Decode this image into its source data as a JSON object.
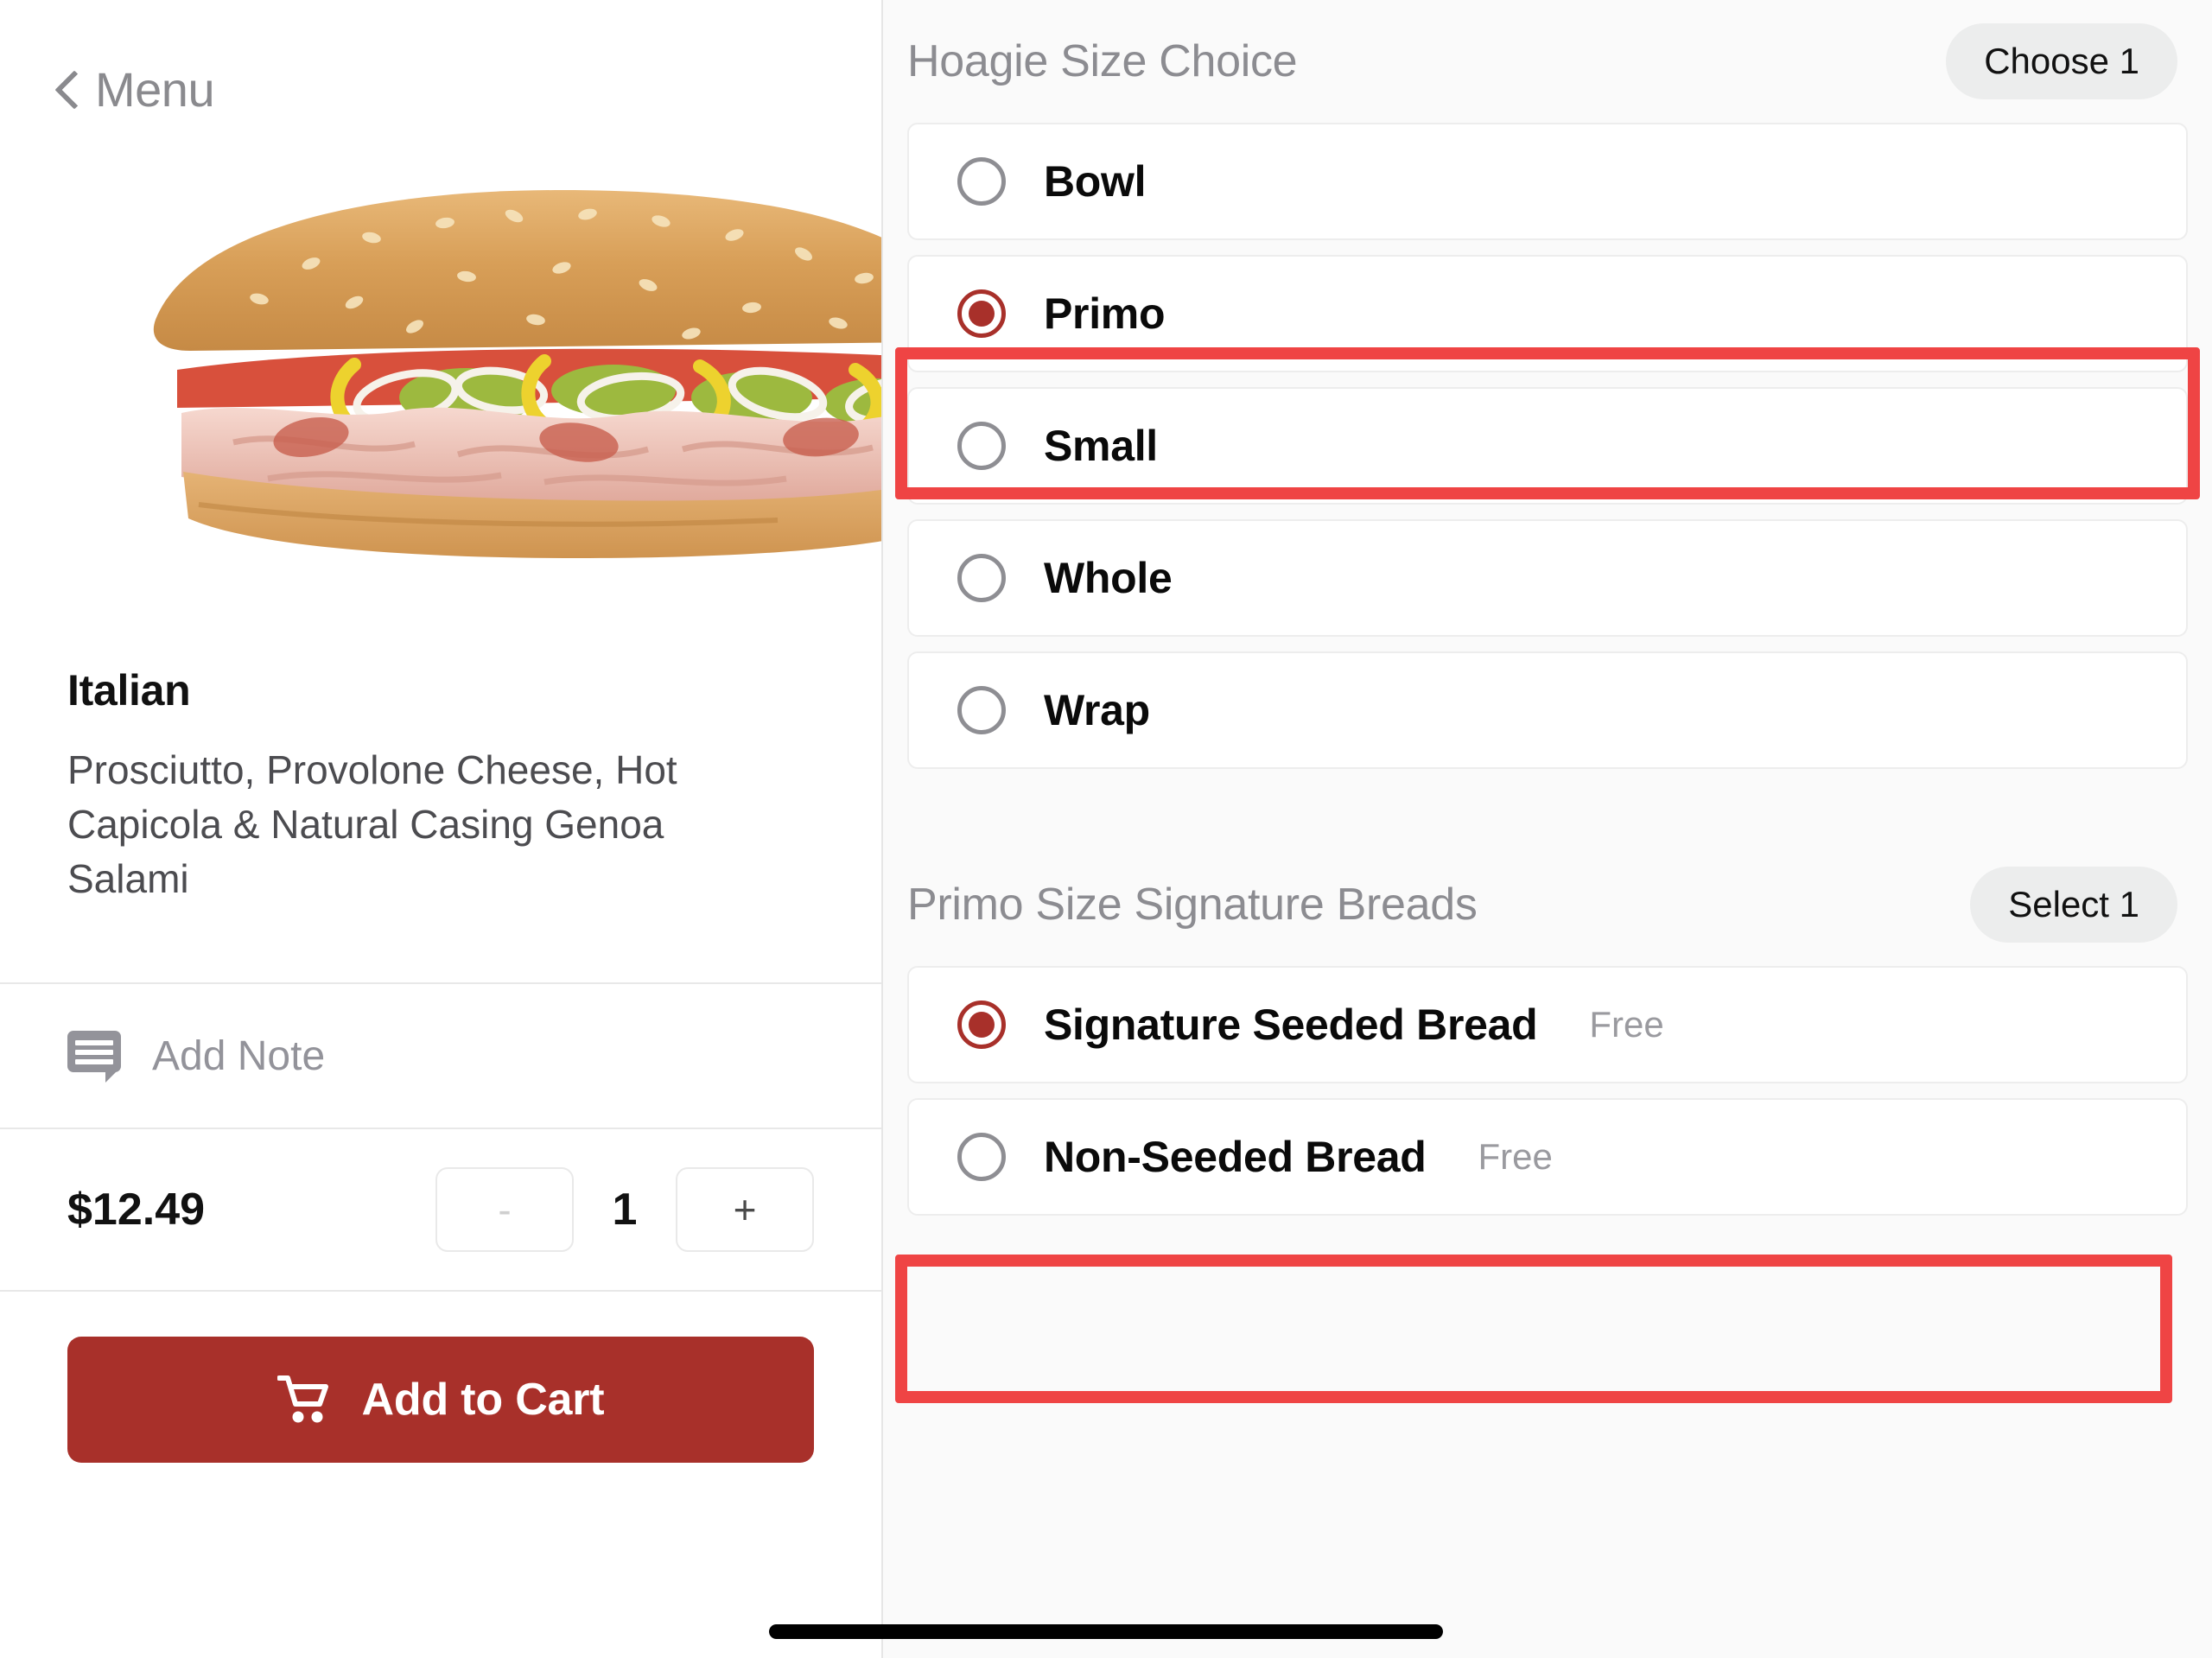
{
  "left": {
    "back_label": "Menu",
    "back_icon": "chevron-left-icon",
    "product": {
      "title": "Italian",
      "description": "Prosciutto, Provolone Cheese, Hot Capicola & Natural Casing Genoa Salami",
      "image_alt": "italian-hoagie-photo"
    },
    "note": {
      "icon": "note-bubble-icon",
      "label": "Add Note"
    },
    "price": "$12.49",
    "stepper": {
      "decrement_label": "-",
      "quantity": "1",
      "increment_label": "+"
    },
    "cart": {
      "icon": "shopping-cart-icon",
      "label": "Add to Cart"
    }
  },
  "right": {
    "sections": [
      {
        "title": "Hoagie Size Choice",
        "badge": "Choose 1",
        "options": [
          {
            "label": "Bowl",
            "price": "",
            "selected": false,
            "highlighted": false
          },
          {
            "label": "Primo",
            "price": "",
            "selected": true,
            "highlighted": true
          },
          {
            "label": "Small",
            "price": "",
            "selected": false,
            "highlighted": false
          },
          {
            "label": "Whole",
            "price": "",
            "selected": false,
            "highlighted": false
          },
          {
            "label": "Wrap",
            "price": "",
            "selected": false,
            "highlighted": false
          }
        ]
      },
      {
        "title": "Primo Size Signature Breads",
        "badge": "Select 1",
        "options": [
          {
            "label": "Signature Seeded Bread",
            "price": "Free",
            "selected": true,
            "highlighted": true
          },
          {
            "label": "Non-Seeded Bread",
            "price": "Free",
            "selected": false,
            "highlighted": false
          }
        ]
      }
    ]
  },
  "colors": {
    "brand_red": "#a8302a",
    "annotation_red": "#ef4444",
    "panel_bg": "#fafafa",
    "muted_text": "#8c8c91"
  }
}
